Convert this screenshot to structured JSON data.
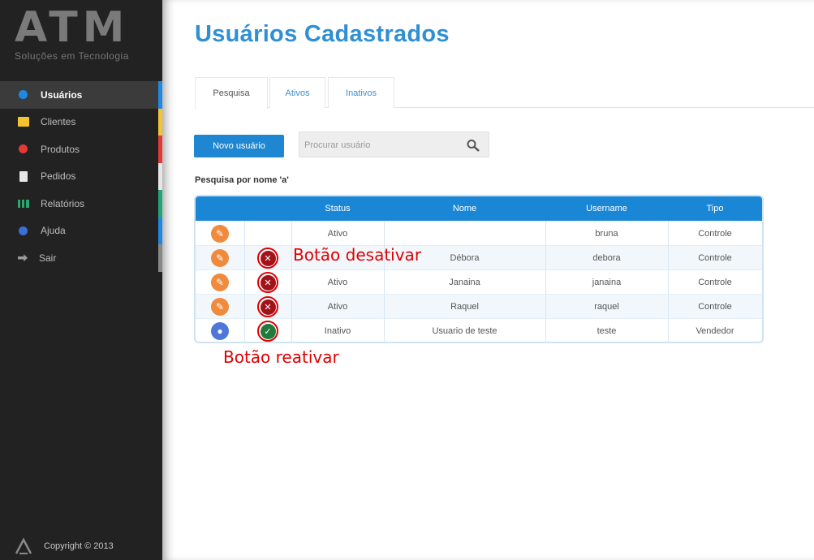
{
  "brand": {
    "logo_text": "ATM",
    "tagline": "Soluções em Tecnologia"
  },
  "sidebar": {
    "items": [
      {
        "label": "Usuários",
        "icon": "users-icon",
        "color": "#1e88e5",
        "stripe": "#1e88e5",
        "active": true
      },
      {
        "label": "Clientes",
        "icon": "envelope-icon",
        "color": "#f4c430",
        "stripe": "#f4c430",
        "active": false
      },
      {
        "label": "Produtos",
        "icon": "products-icon",
        "color": "#e53935",
        "stripe": "#e53935",
        "active": false
      },
      {
        "label": "Pedidos",
        "icon": "document-icon",
        "color": "#e6e6e6",
        "stripe": "#e6e6e6",
        "active": false
      },
      {
        "label": "Relatórios",
        "icon": "bar-chart-icon",
        "color": "#2aa86f",
        "stripe": "#1fa577",
        "active": false
      },
      {
        "label": "Ajuda",
        "icon": "help-icon",
        "color": "#3a6fd8",
        "stripe": "#1e88e5",
        "active": false
      },
      {
        "label": "Sair",
        "icon": "exit-icon",
        "color": "#9a9a9a",
        "stripe": "#888888",
        "active": false
      }
    ],
    "footer": "Copyright © 2013"
  },
  "page": {
    "title": "Usuários Cadastrados"
  },
  "tabs": [
    {
      "label": "Pesquisa",
      "active": true
    },
    {
      "label": "Ativos",
      "active": false
    },
    {
      "label": "Inativos",
      "active": false
    }
  ],
  "toolbar": {
    "new_user_label": "Novo usuário",
    "search_placeholder": "Procurar usuário"
  },
  "search_caption": "Pesquisa por nome 'a'",
  "table": {
    "headers": [
      "Status",
      "Nome",
      "Username",
      "Tipo"
    ],
    "rows": [
      {
        "status": "Ativo",
        "nome": "",
        "username": "bruna",
        "tipo": "Controle",
        "action": "edit",
        "toggle": ""
      },
      {
        "status": "",
        "nome": "Débora",
        "username": "debora",
        "tipo": "Controle",
        "action": "edit",
        "toggle": "deactivate"
      },
      {
        "status": "Ativo",
        "nome": "Janaina",
        "username": "janaina",
        "tipo": "Controle",
        "action": "edit",
        "toggle": "deactivate"
      },
      {
        "status": "Ativo",
        "nome": "Raquel",
        "username": "raquel",
        "tipo": "Controle",
        "action": "edit",
        "toggle": "deactivate"
      },
      {
        "status": "Inativo",
        "nome": "Usuario de teste",
        "username": "teste",
        "tipo": "Vendedor",
        "action": "view",
        "toggle": "reactivate"
      }
    ]
  },
  "annotations": {
    "deactivate": "Botão desativar",
    "reactivate": "Botão reativar"
  },
  "colors": {
    "accent": "#1a87d6",
    "title": "#2f8fd5",
    "annotation": "#e00000",
    "sidebar_bg": "#222222"
  }
}
